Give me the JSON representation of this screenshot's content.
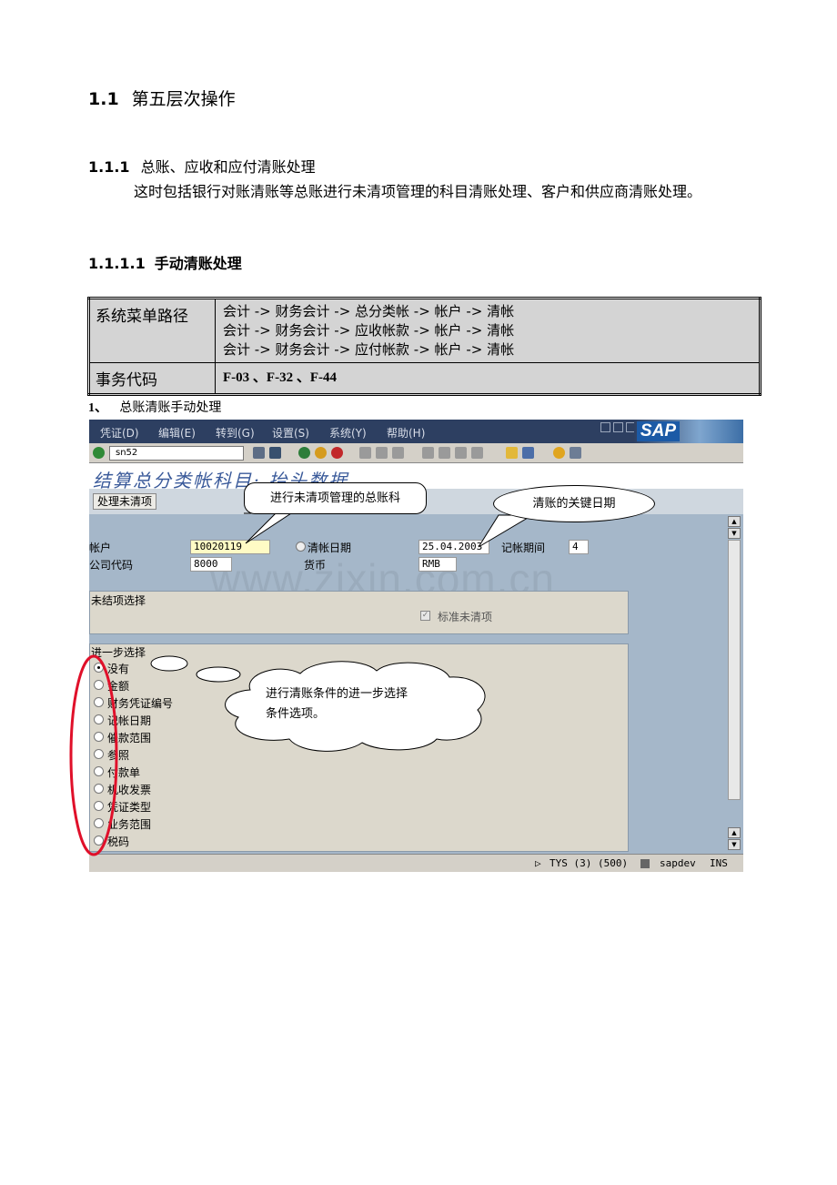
{
  "heading1": {
    "num": "1.1",
    "text": "第五层次操作"
  },
  "heading2": {
    "num": "1.1.1",
    "text": "总账、应收和应付清账处理"
  },
  "paragraph": "这时包括银行对账清账等总账进行未清项管理的科目清账处理、客户和供应商清账处理。",
  "heading3": {
    "num": "1.1.1.1",
    "text": "手动清账处理"
  },
  "table": {
    "menu_label": "系统菜单路径",
    "menu_paths": [
      "会计 -> 财务会计 -> 总分类帐 -> 帐户 -> 清帐",
      "会计 -> 财务会计 -> 应收帐款 -> 帐户 -> 清帐",
      "会计 -> 财务会计 -> 应付帐款 -> 帐户 -> 清帐"
    ],
    "code_label": "事务代码",
    "codes": "F-03 、F-32 、F-44"
  },
  "caption": {
    "num": "1、",
    "text": "总账清账手动处理"
  },
  "sap": {
    "menu": [
      "凭证(D)",
      "编辑(E)",
      "转到(G)",
      "设置(S)",
      "系统(Y)",
      "帮助(H)"
    ],
    "logo": "SAP",
    "command": "sn52",
    "title": "结算总分类帐科目: 抬头数据",
    "open_items_button": "处理未清项",
    "account_label": "帐户",
    "account_value": "10020119",
    "company_label": "公司代码",
    "company_value": "8000",
    "clearing_date_label": "清帐日期",
    "clearing_date_value": "25.04.2003",
    "period_label": "记帐期间",
    "period_value": "4",
    "currency_label": "货币",
    "currency_value": "RMB",
    "open_item_group": "未结项选择",
    "standard_open_items": "标准未清项",
    "further_group": "进一步选择",
    "options": [
      "没有",
      "金额",
      "财务凭证编号",
      "记帐日期",
      "催款范围",
      "参照",
      "付款单",
      "机收发票",
      "凭证类型",
      "业务范围",
      "税码"
    ],
    "status": {
      "system": "TYS (3) (500)",
      "server": "sapdev",
      "mode": "INS"
    },
    "watermark": "www.zixin.com.cn"
  },
  "callouts": {
    "account": "进行未清项管理的总账科",
    "date": "清账的关键日期",
    "further_line1": "进行清账条件的进一步选择",
    "further_line2": "条件选项。"
  },
  "colors": {
    "sap_bg": "#a5b7c9",
    "menubar": "#2d3f61",
    "title_text": "#3a5a9a",
    "highlight_ring": "#e0102a"
  }
}
